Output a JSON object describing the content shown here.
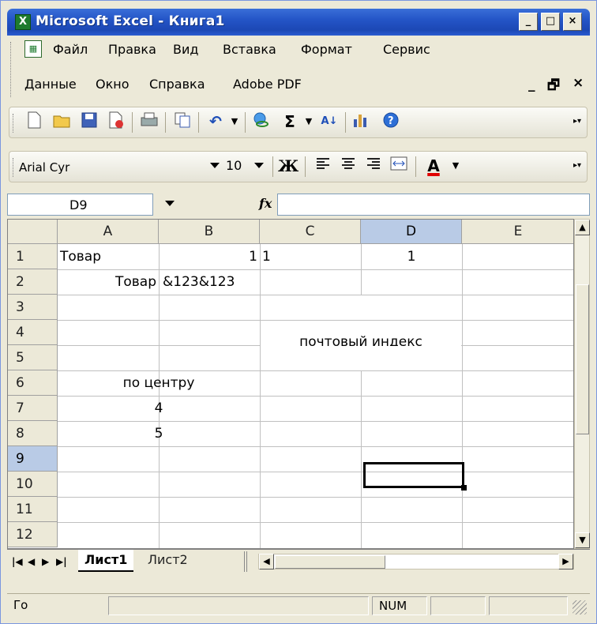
{
  "window": {
    "app_icon": "excel-icon",
    "title": "Microsoft Excel - Книга1",
    "minimize": "_",
    "maximize": "□",
    "close": "×"
  },
  "menubar": {
    "items": [
      {
        "label": "Файл"
      },
      {
        "label": "Правка"
      },
      {
        "label": "Вид"
      },
      {
        "label": "Вставка"
      },
      {
        "label": "Формат"
      },
      {
        "label": "Сервис"
      },
      {
        "label": "Данные"
      },
      {
        "label": "Окно"
      },
      {
        "label": "Справка"
      },
      {
        "label": "Adobe PDF"
      }
    ],
    "doc_minimize": "_",
    "doc_restore": "🗗",
    "doc_close": "×"
  },
  "standard_toolbar": {
    "icons": [
      "new-icon",
      "open-icon",
      "save-icon",
      "permission-icon",
      "print-icon",
      "copy-icon",
      "undo-icon",
      "hyperlink-icon",
      "autosum-icon",
      "sort-icon",
      "chart-icon",
      "help-icon"
    ]
  },
  "formatting_toolbar": {
    "font": "Arial Cyr",
    "size": "10",
    "bold_label": "Ж"
  },
  "formula_bar": {
    "name_box": "D9",
    "fx": "fx",
    "formula": ""
  },
  "grid": {
    "columns": [
      "A",
      "B",
      "C",
      "D",
      "E"
    ],
    "rows": [
      "1",
      "2",
      "3",
      "4",
      "5",
      "6",
      "7",
      "8",
      "9",
      "10",
      "11",
      "12"
    ],
    "active_column": "D",
    "active_row": "9",
    "cells": {
      "A1": "Товар",
      "B1": "1",
      "C1": "1",
      "D1": "1",
      "A2": "Товар",
      "B2": "&123&123",
      "C4": "почтовый индекс",
      "A6": "по центру",
      "A7": "4",
      "A8": "5"
    }
  },
  "sheets": {
    "tabs": [
      "Лист1",
      "Лист2"
    ],
    "active": "Лист1"
  },
  "statusbar": {
    "mode": "Го",
    "num": "NUM"
  },
  "colors": {
    "title_blue": "#2455c7",
    "chrome": "#ece9d8",
    "active_header": "#b9cbe6",
    "font_color_red": "#e00000"
  }
}
